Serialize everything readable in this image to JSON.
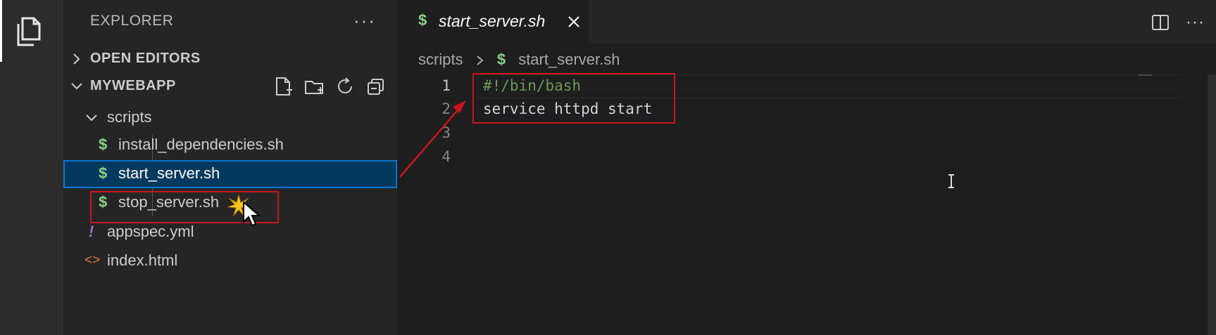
{
  "activity_bar": {
    "items": [
      {
        "icon": "files-icon",
        "active": true
      }
    ]
  },
  "sidebar": {
    "header": "EXPLORER",
    "menu_label": "···",
    "open_editors": {
      "title": "OPEN EDITORS",
      "expanded": false
    },
    "project": {
      "title": "MYWEBAPP",
      "expanded": true,
      "actions": [
        "new-file-icon",
        "new-folder-icon",
        "refresh-icon",
        "collapse-all-icon"
      ]
    },
    "tree": [
      {
        "label": "scripts",
        "type": "folder",
        "expanded": true
      },
      {
        "label": "install_dependencies.sh",
        "type": "sh",
        "glyph": "$"
      },
      {
        "label": "start_server.sh",
        "type": "sh",
        "glyph": "$",
        "selected": true
      },
      {
        "label": "stop_server.sh",
        "type": "sh",
        "glyph": "$"
      },
      {
        "label": "appspec.yml",
        "type": "yml",
        "glyph": "!"
      },
      {
        "label": "index.html",
        "type": "html",
        "glyph": "<>"
      }
    ]
  },
  "editor": {
    "tab": {
      "glyph": "$",
      "label": "start_server.sh",
      "close": "close-icon"
    },
    "actions": [
      "split-editor-icon",
      "more-actions-icon"
    ],
    "actions_more_label": "···",
    "breadcrumb": {
      "folder": "scripts",
      "glyph": "$",
      "file": "start_server.sh"
    },
    "line_numbers": [
      "1",
      "2",
      "3",
      "4"
    ],
    "lines": [
      "#!/bin/bash",
      "service httpd start",
      "",
      ""
    ]
  },
  "colors": {
    "accent": "#0078d4",
    "selection": "#04395e",
    "annotation_red": "#c8161e",
    "sh_icon": "#89d185",
    "yml_icon": "#a074c4",
    "html_icon": "#e37933",
    "comment": "#6a9955"
  }
}
